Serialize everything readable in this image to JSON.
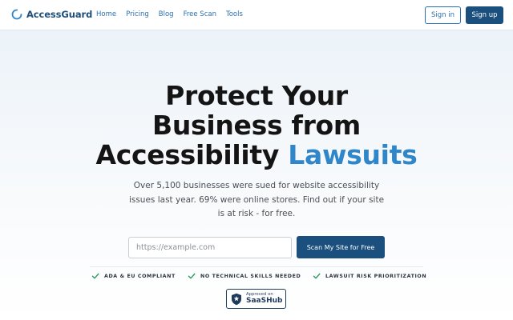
{
  "brand": {
    "name": "AccessGuard",
    "color": "#1e4e7a",
    "accent": "#2f86c9",
    "icon": "circle-arc-logo-icon"
  },
  "nav": {
    "links": [
      "Home",
      "Pricing",
      "Blog",
      "Free Scan",
      "Tools"
    ],
    "signin_label": "Sign in",
    "signup_label": "Sign up"
  },
  "hero": {
    "title_line1": "Protect Your",
    "title_line2": "Business from",
    "title_line3_plain": "Accessibility ",
    "title_line3_accent": "Lawsuits",
    "subtitle": "Over 5,100 businesses were sued for website accessibility issues last year. 69% were online stores. Find out if your site is at risk - for free."
  },
  "scan_form": {
    "placeholder": "https://example.com",
    "value": "",
    "button_label": "Scan My Site for Free"
  },
  "features": [
    {
      "icon": "checkmark-icon",
      "label": "ADA & EU COMPLIANT"
    },
    {
      "icon": "checkmark-icon",
      "label": "NO TECHNICAL SKILLS NEEDED"
    },
    {
      "icon": "checkmark-icon",
      "label": "LAWSUIT RISK PRIORITIZATION"
    }
  ],
  "badge": {
    "icon": "star-shield-icon",
    "small_text": "Approved on",
    "big_text": "SaaSHub"
  },
  "colors": {
    "primary_button": "#1a4f7e",
    "link": "#2a6fb0",
    "check": "#2e9a5a"
  }
}
